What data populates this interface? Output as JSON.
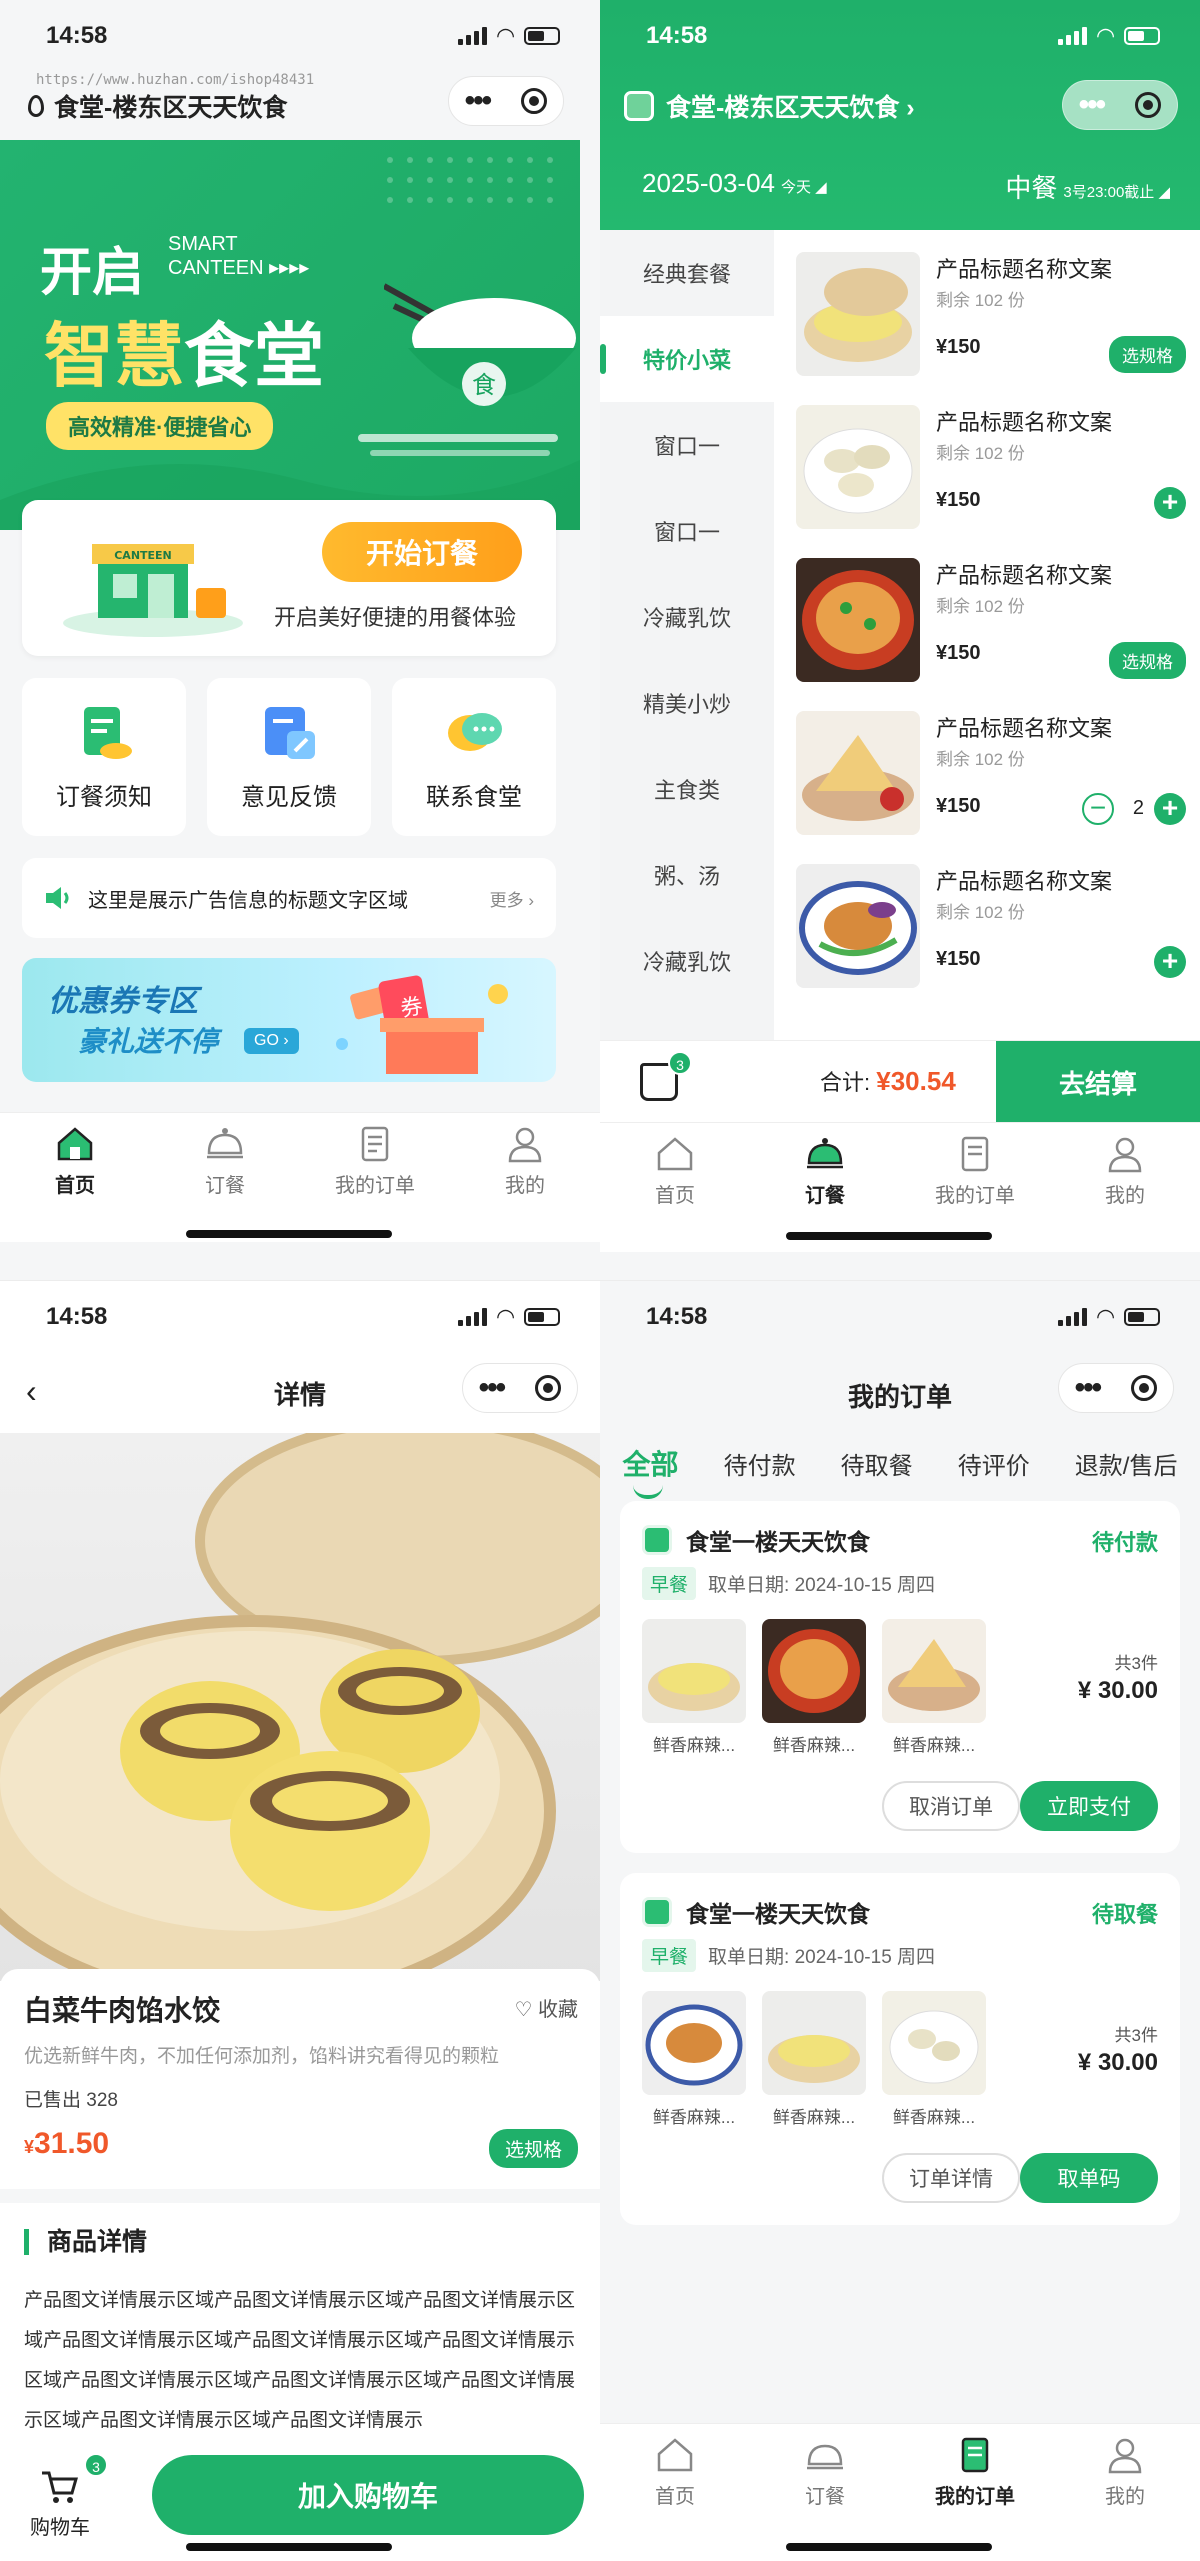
{
  "status_time": "14:58",
  "colors": {
    "accent": "#1fb06a",
    "price": "#f0582a",
    "orange": "#ffa321"
  },
  "home": {
    "location": "食堂-楼东区天天饮食",
    "watermark": "https://www.huzhan.com/ishop48431",
    "hero": {
      "open": "开启",
      "smart": "SMART",
      "canteen": "CANTEEN ▸▸▸▸",
      "title_a": "智慧",
      "title_b": "食堂",
      "slogan": "高效精准·便捷省心",
      "badge": "食"
    },
    "start": {
      "shop_sign": "CANTEEN",
      "button": "开始订餐",
      "desc": "开启美好便捷的用餐体验"
    },
    "shortcuts": [
      {
        "label": "订餐须知",
        "icon": "document-icon"
      },
      {
        "label": "意见反馈",
        "icon": "feedback-icon"
      },
      {
        "label": "联系食堂",
        "icon": "chat-icon"
      }
    ],
    "notice": {
      "text": "这里是展示广告信息的标题文字区域",
      "more": "更多 ›"
    },
    "coupon": {
      "line1": "优惠券专区",
      "line2": "豪礼送不停",
      "go": "GO ›",
      "box": "券"
    }
  },
  "tabs": [
    {
      "label": "首页",
      "icon": "home-icon"
    },
    {
      "label": "订餐",
      "icon": "cloche-icon"
    },
    {
      "label": "我的订单",
      "icon": "orders-icon"
    },
    {
      "label": "我的",
      "icon": "user-icon"
    }
  ],
  "order_page": {
    "location": "食堂-楼东区天天饮食 ›",
    "date": "2025-03-04",
    "date_tag": "今天 ◢",
    "meal": "中餐",
    "meal_note": "3号23:00截止 ◢",
    "categories": [
      "经典套餐",
      "特价小菜",
      "窗口一",
      "窗口一",
      "冷藏乳饮",
      "精美小炒",
      "主食类",
      "粥、汤",
      "冷藏乳饮"
    ],
    "products": [
      {
        "title": "产品标题名称文案",
        "stock": "剩余 102 份",
        "price": "¥150",
        "action": "选规格"
      },
      {
        "title": "产品标题名称文案",
        "stock": "剩余 102 份",
        "price": "¥150",
        "action": "+"
      },
      {
        "title": "产品标题名称文案",
        "stock": "剩余 102 份",
        "price": "¥150",
        "action": "选规格"
      },
      {
        "title": "产品标题名称文案",
        "stock": "剩余 102 份",
        "price": "¥150",
        "qty": "2"
      },
      {
        "title": "产品标题名称文案",
        "stock": "剩余 102 份",
        "price": "¥150",
        "action": "+"
      }
    ],
    "cart": {
      "count": "3",
      "total_label": "合计:",
      "total": "¥30.54",
      "checkout": "去结算"
    }
  },
  "detail": {
    "title": "详情",
    "name": "白菜牛肉馅水饺",
    "fav": "收藏",
    "desc": "优选新鲜牛肉，不加任何添加剂，馅料讲究看得见的颗粒",
    "sold": "已售出 328",
    "price_symbol": "¥",
    "price": "31.50",
    "spec": "选规格",
    "section": "商品详情",
    "text": "产品图文详情展示区域产品图文详情展示区域产品图文详情展示区域产品图文详情展示区域产品图文详情展示区域产品图文详情展示区域产品图文详情展示区域产品图文详情展示区域产品图文详情展示区域产品图文详情展示区域产品图文详情展示",
    "cart_label": "购物车",
    "cart_count": "3",
    "add_cart": "加入购物车"
  },
  "orders": {
    "title": "我的订单",
    "tabs": [
      "全部",
      "待付款",
      "待取餐",
      "待评价",
      "退款/售后"
    ],
    "list": [
      {
        "shop": "食堂一楼天天饮食",
        "status": "待付款",
        "meal": "早餐",
        "date": "取单日期: 2024-10-15 周四",
        "items": [
          "鲜香麻辣...",
          "鲜香麻辣...",
          "鲜香麻辣..."
        ],
        "count": "共3件",
        "price": "¥ 30.00",
        "btn1": "取消订单",
        "btn2": "立即支付"
      },
      {
        "shop": "食堂一楼天天饮食",
        "status": "待取餐",
        "meal": "早餐",
        "date": "取单日期: 2024-10-15 周四",
        "items": [
          "鲜香麻辣...",
          "鲜香麻辣...",
          "鲜香麻辣..."
        ],
        "count": "共3件",
        "price": "¥ 30.00",
        "btn1": "订单详情",
        "btn2": "取单码"
      }
    ]
  }
}
